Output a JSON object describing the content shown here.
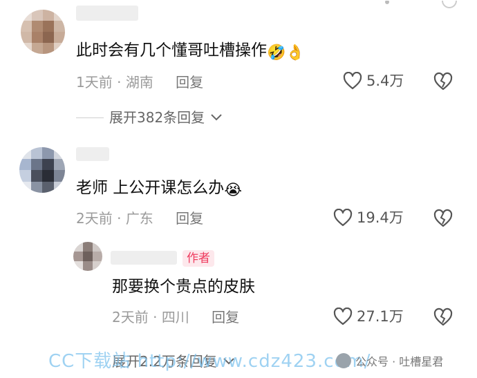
{
  "comments": [
    {
      "text": "此时会有几个懂哥吐槽操作",
      "emojis": [
        "🤣",
        "👌"
      ],
      "time": "1天前",
      "sep": "·",
      "location": "湖南",
      "reply_label": "回复",
      "likes": "5.4万",
      "expand_text": "展开382条回复"
    },
    {
      "text": "老师 上公开课怎么办",
      "emojis": [
        "😭"
      ],
      "time": "2天前",
      "sep": "·",
      "location": "广东",
      "reply_label": "回复",
      "likes": "19.4万"
    }
  ],
  "reply": {
    "badge": "作者",
    "text": "那要换个贵点的皮肤",
    "time": "2天前",
    "sep": "·",
    "location": "四川",
    "reply_label": "回复",
    "likes": "27.1万"
  },
  "bottom_expand": "展开2.2万条回复",
  "watermark": {
    "left": "CC下载站 http://www.cdz423.com/",
    "right": "公众号 · 吐槽星君"
  },
  "colors": {
    "author_badge_bg": "#fde8ec",
    "author_badge_fg": "#ee3b5e",
    "watermark": "#7fc3ee"
  }
}
